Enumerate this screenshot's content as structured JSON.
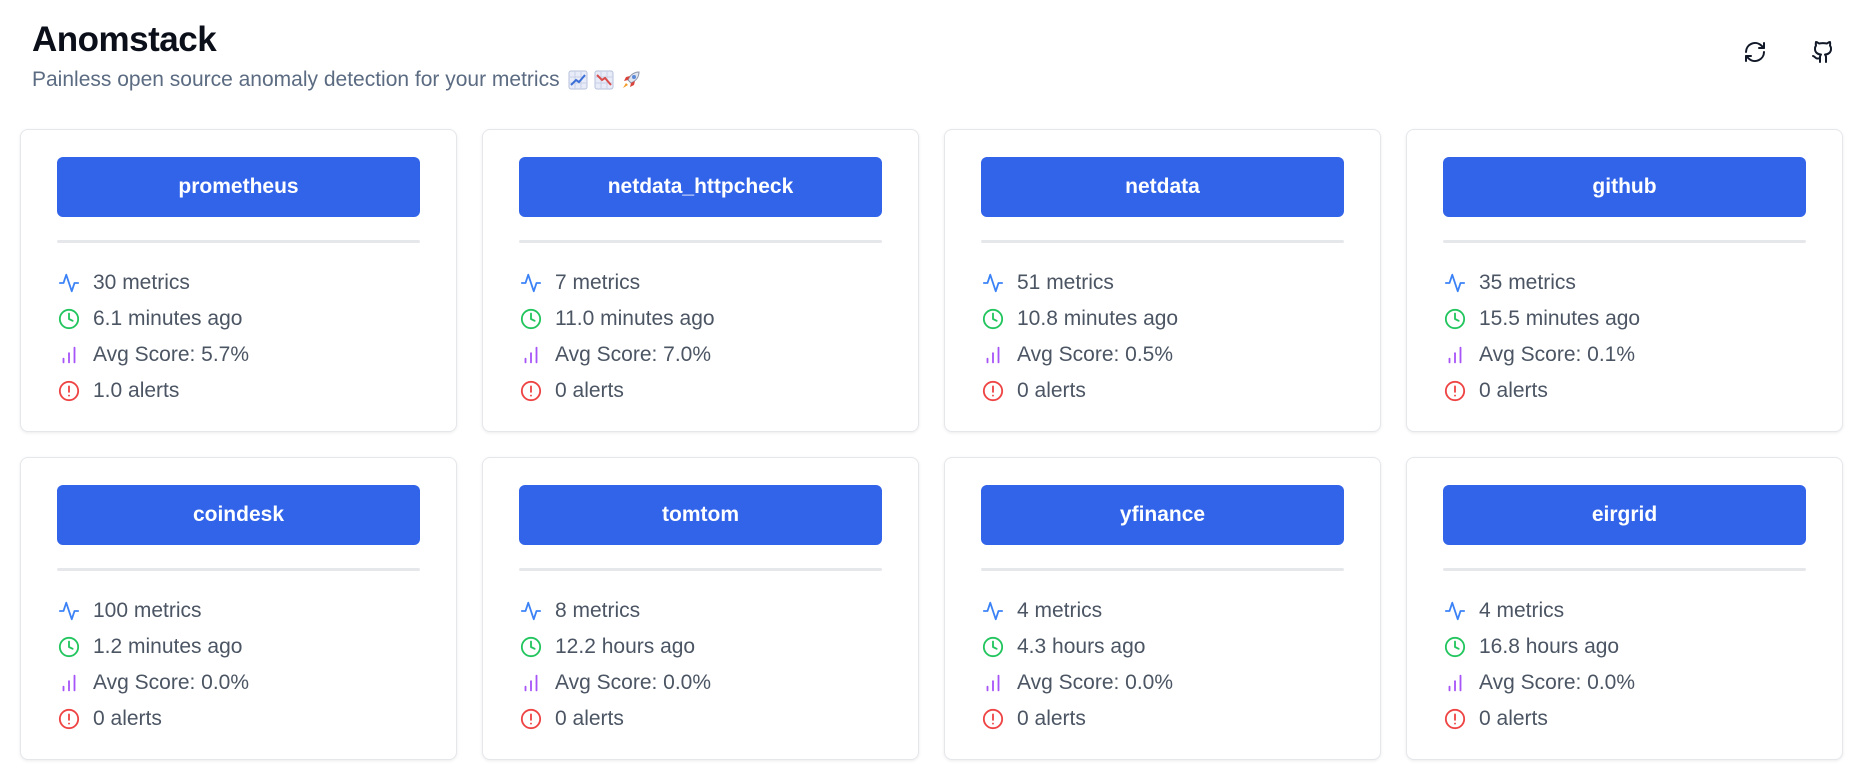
{
  "header": {
    "title": "Anomstack",
    "subtitle": "Painless open source anomaly detection for your metrics",
    "subtitle_emojis": [
      "chart-increasing-icon",
      "chart-decreasing-icon",
      "rocket-icon"
    ]
  },
  "actions": {
    "refresh_icon": "refresh-icon",
    "github_icon": "github-icon"
  },
  "colors": {
    "primary": "#3264ea",
    "metrics_icon": "#3b82f6",
    "time_icon": "#22c55e",
    "score_icon": "#a855f7",
    "alert_icon": "#ef4444"
  },
  "cards": [
    {
      "name": "prometheus",
      "metrics": "30 metrics",
      "updated": "6.1 minutes ago",
      "score": "Avg Score: 5.7%",
      "alerts": "1.0 alerts"
    },
    {
      "name": "netdata_httpcheck",
      "metrics": "7 metrics",
      "updated": "11.0 minutes ago",
      "score": "Avg Score: 7.0%",
      "alerts": "0 alerts"
    },
    {
      "name": "netdata",
      "metrics": "51 metrics",
      "updated": "10.8 minutes ago",
      "score": "Avg Score: 0.5%",
      "alerts": "0 alerts"
    },
    {
      "name": "github",
      "metrics": "35 metrics",
      "updated": "15.5 minutes ago",
      "score": "Avg Score: 0.1%",
      "alerts": "0 alerts"
    },
    {
      "name": "coindesk",
      "metrics": "100 metrics",
      "updated": "1.2 minutes ago",
      "score": "Avg Score: 0.0%",
      "alerts": "0 alerts"
    },
    {
      "name": "tomtom",
      "metrics": "8 metrics",
      "updated": "12.2 hours ago",
      "score": "Avg Score: 0.0%",
      "alerts": "0 alerts"
    },
    {
      "name": "yfinance",
      "metrics": "4 metrics",
      "updated": "4.3 hours ago",
      "score": "Avg Score: 0.0%",
      "alerts": "0 alerts"
    },
    {
      "name": "eirgrid",
      "metrics": "4 metrics",
      "updated": "16.8 hours ago",
      "score": "Avg Score: 0.0%",
      "alerts": "0 alerts"
    }
  ]
}
